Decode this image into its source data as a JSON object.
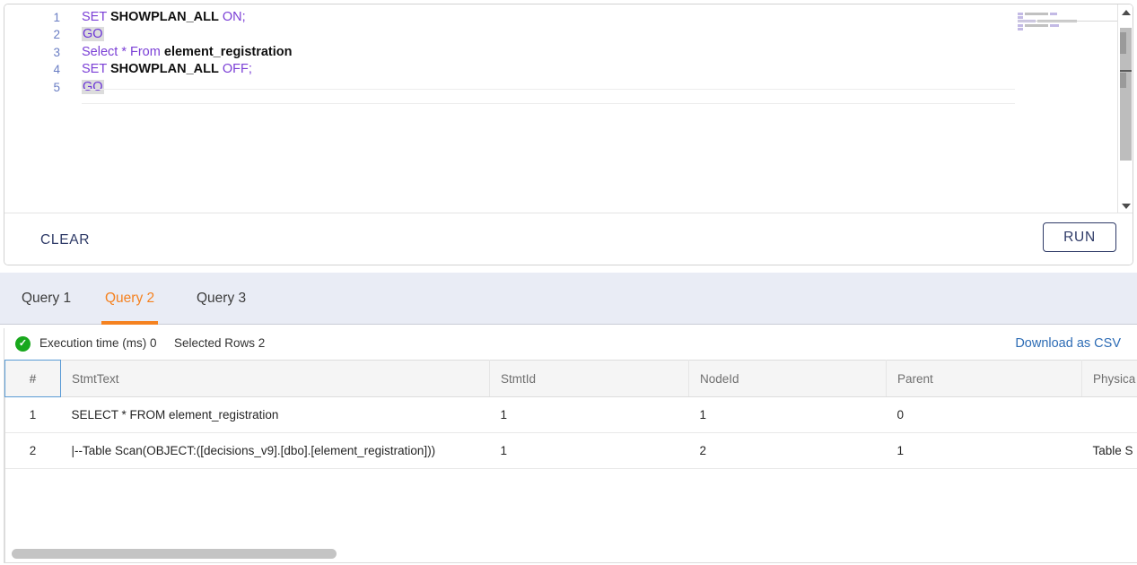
{
  "editor": {
    "lines": [
      {
        "num": "1",
        "tokens": [
          {
            "t": "SET",
            "c": "kw"
          },
          {
            "t": " ",
            "c": "sp"
          },
          {
            "t": "SHOWPLAN_ALL",
            "c": "plain"
          },
          {
            "t": " ",
            "c": "sp"
          },
          {
            "t": "ON",
            "c": "kw"
          },
          {
            "t": ";",
            "c": "kw"
          }
        ]
      },
      {
        "num": "2",
        "tokens": [
          {
            "t": "GO",
            "c": "go"
          }
        ]
      },
      {
        "num": "3",
        "tokens": [
          {
            "t": "Select * From",
            "c": "kw"
          },
          {
            "t": " ",
            "c": "sp"
          },
          {
            "t": "element_registration",
            "c": "plain"
          }
        ]
      },
      {
        "num": "4",
        "tokens": [
          {
            "t": "SET",
            "c": "kw"
          },
          {
            "t": " ",
            "c": "sp"
          },
          {
            "t": "SHOWPLAN_ALL",
            "c": "plain"
          },
          {
            "t": " ",
            "c": "sp"
          },
          {
            "t": "OFF",
            "c": "kw"
          },
          {
            "t": ";",
            "c": "kw"
          }
        ]
      },
      {
        "num": "5",
        "tokens": [
          {
            "t": "GO",
            "c": "go"
          }
        ]
      }
    ],
    "full_text": "SET SHOWPLAN_ALL ON;\nGO\nSelect * From element_registration\nSET SHOWPLAN_ALL OFF;\nGO",
    "colors": {
      "keyword": "#7b3fd6",
      "line_number": "#6a7ec4",
      "identifier": "#111111",
      "go_highlight_bg": "#dcdcdc"
    }
  },
  "toolbar": {
    "clear_label": "CLEAR",
    "run_label": "RUN",
    "accent": "#2e3a67"
  },
  "tabs": {
    "active_index": 1,
    "accent": "#f58220",
    "items": [
      {
        "label": "Query 1"
      },
      {
        "label": "Query 2"
      },
      {
        "label": "Query 3"
      }
    ]
  },
  "results": {
    "status": {
      "icon": "check-circle-icon",
      "icon_color": "#18a81c",
      "execution_time": "Execution time (ms) 0",
      "selected_rows": "Selected Rows 2"
    },
    "download_label": "Download as CSV",
    "download_color": "#2d6cb5",
    "columns": [
      {
        "label": "#"
      },
      {
        "label": "StmtText"
      },
      {
        "label": "StmtId"
      },
      {
        "label": "NodeId"
      },
      {
        "label": "Parent"
      },
      {
        "label": "Physica"
      }
    ],
    "rows": [
      {
        "index": "1",
        "stmt_text": "SELECT * FROM  element_registration",
        "stmt_id": "1",
        "node_id": "1",
        "parent": "0",
        "physical_op": ""
      },
      {
        "index": "2",
        "stmt_text": "  |--Table Scan(OBJECT:([decisions_v9].[dbo].[element_registration]))",
        "stmt_id": "1",
        "node_id": "2",
        "parent": "1",
        "physical_op": "Table S"
      }
    ]
  }
}
